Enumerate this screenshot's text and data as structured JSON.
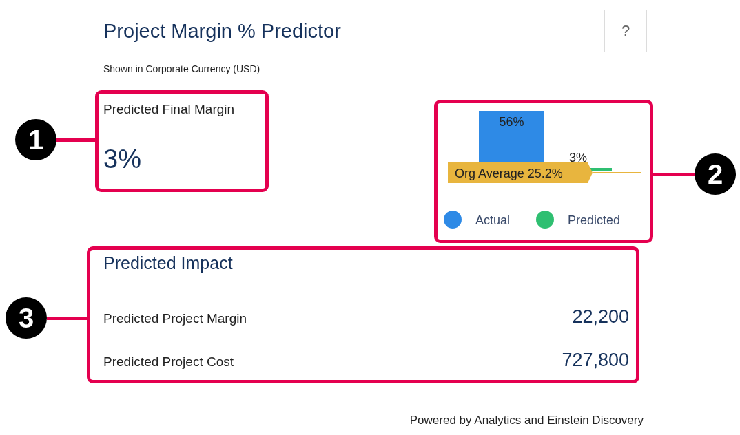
{
  "header": {
    "title": "Project Margin % Predictor",
    "help_button": "?",
    "subtitle": "Shown in Corporate Currency (USD)"
  },
  "final_margin": {
    "label": "Predicted Final Margin",
    "value": "3%"
  },
  "chart": {
    "bars": [
      {
        "value_label": "56%",
        "color": "#2e8ae6"
      },
      {
        "value_label": "3%",
        "color": "#2fbf71"
      }
    ],
    "org_average": "Org Average 25.2%",
    "legend": [
      {
        "label": "Actual",
        "color": "#2e8ae6"
      },
      {
        "label": "Predicted",
        "color": "#2fbf71"
      }
    ]
  },
  "impact": {
    "title": "Predicted Impact",
    "rows": [
      {
        "label": "Predicted Project Margin",
        "value": "22,200"
      },
      {
        "label": "Predicted Project Cost",
        "value": "727,800"
      }
    ]
  },
  "footer": "Powered by Analytics and Einstein Discovery",
  "callouts": [
    {
      "number": "1"
    },
    {
      "number": "2"
    },
    {
      "number": "3"
    }
  ]
}
